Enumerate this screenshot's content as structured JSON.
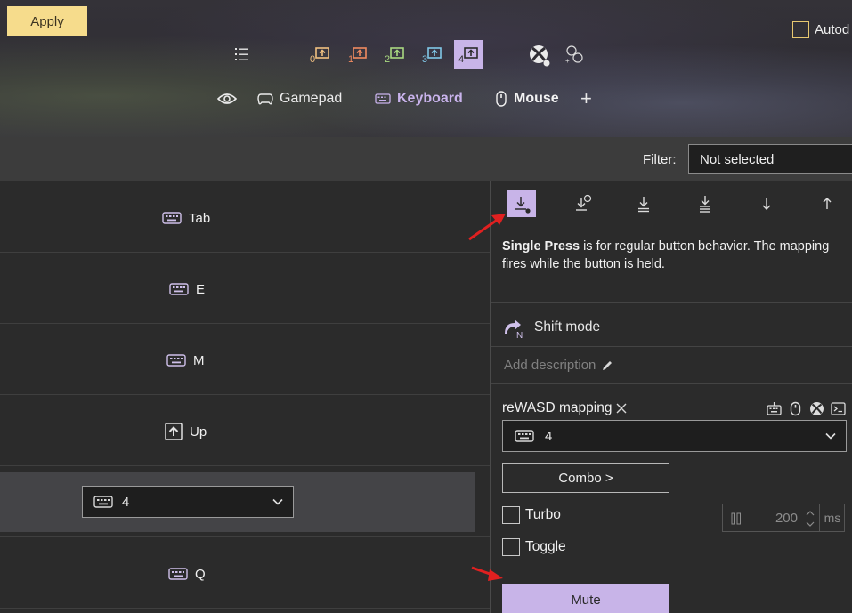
{
  "header": {
    "apply_label": "Apply",
    "autodetect_label": "Autod",
    "slots": [
      {
        "label": "0",
        "color": "#f0c080"
      },
      {
        "label": "1",
        "color": "#f08a60"
      },
      {
        "label": "2",
        "color": "#a8d880"
      },
      {
        "label": "3",
        "color": "#80c8e8"
      },
      {
        "label": "4",
        "color": "#2a2a2a",
        "active": true
      }
    ],
    "tabs": {
      "gamepad": "Gamepad",
      "keyboard": "Keyboard",
      "mouse": "Mouse",
      "add": "+"
    }
  },
  "filter": {
    "label": "Filter:",
    "value": "Not selected"
  },
  "mapping_rows": [
    {
      "icon": "keyboard-icon",
      "label": "Tab"
    },
    {
      "icon": "keyboard-icon",
      "label": "E"
    },
    {
      "icon": "keyboard-icon",
      "label": "M"
    },
    {
      "icon": "arrow-up-icon",
      "label": "Up"
    },
    {
      "icon": "keyboard-icon",
      "label": "4",
      "selected": true
    },
    {
      "icon": "keyboard-icon",
      "label": "Q"
    }
  ],
  "panel": {
    "description_bold": "Single Press",
    "description_rest": " is for regular button behavior. The mapping fires while the button is held.",
    "shift_mode_label": "Shift mode",
    "add_description_placeholder": "Add description",
    "mapping_title": "reWASD mapping",
    "mapping_value": "4",
    "combo_label": "Combo >",
    "turbo_label": "Turbo",
    "toggle_label": "Toggle",
    "turbo_value": "200",
    "turbo_unit": "ms",
    "mute_label": "Mute"
  },
  "colors": {
    "accent": "#c8b4e8",
    "apply": "#f6dc8c",
    "annotation_arrow": "#e02020"
  }
}
